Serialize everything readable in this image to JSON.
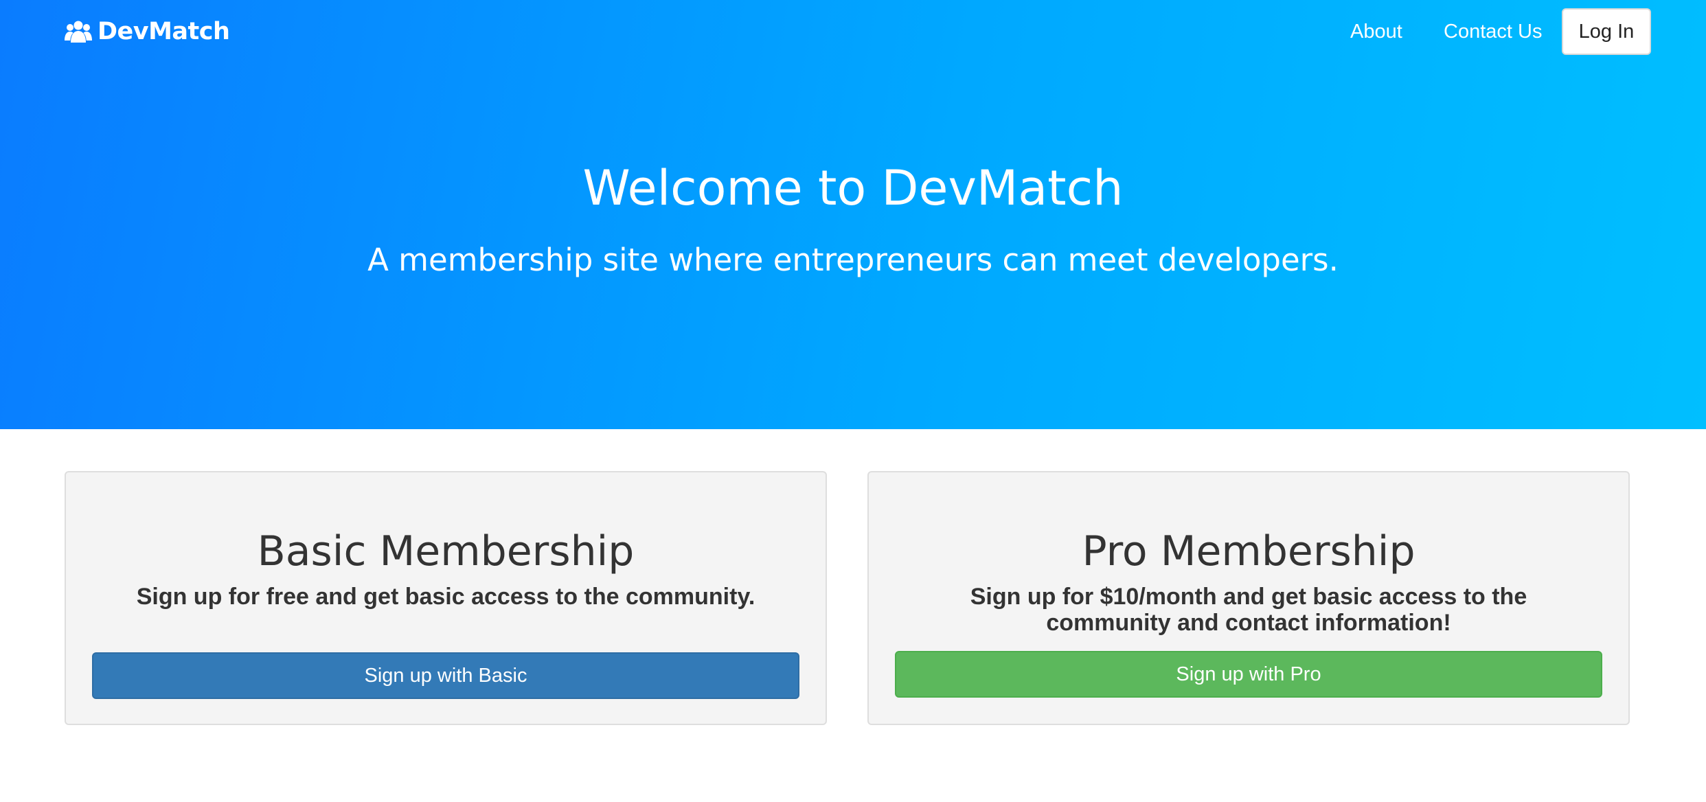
{
  "navbar": {
    "brand": "DevMatch",
    "brand_icon": "users-icon",
    "links": [
      {
        "label": "About"
      },
      {
        "label": "Contact Us"
      }
    ],
    "login_label": "Log In"
  },
  "hero": {
    "title": "Welcome to DevMatch",
    "subtitle": "A membership site where entrepreneurs can meet developers."
  },
  "plans": [
    {
      "title": "Basic Membership",
      "description": "Sign up for free and get basic access to the community.",
      "button_label": "Sign up with Basic",
      "button_color": "#337ab7"
    },
    {
      "title": "Pro Membership",
      "description": "Sign up for $10/month and get basic access to the community and contact information!",
      "button_label": "Sign up with Pro",
      "button_color": "#5cb85c"
    }
  ],
  "colors": {
    "hero_gradient_start": "#0a7cff",
    "hero_gradient_end": "#00bfff",
    "card_background": "#f4f4f4"
  }
}
